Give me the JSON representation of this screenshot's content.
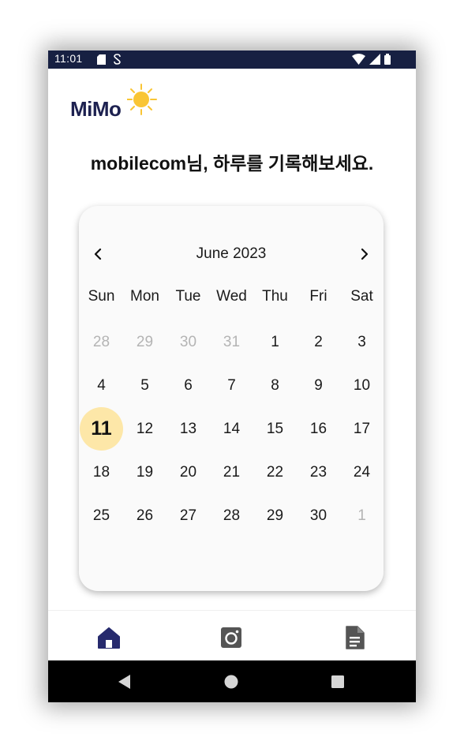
{
  "status_bar": {
    "time": "11:01",
    "icons_left": [
      "sd-card-icon",
      "sync-icon"
    ],
    "icons_right": [
      "wifi-icon",
      "signal-icon",
      "battery-icon"
    ]
  },
  "app": {
    "logo_text": "MiMo",
    "greeting": "mobilecom님, 하루를 기록해보세요."
  },
  "calendar": {
    "month_label": "June 2023",
    "prev_icon": "chevron-left-icon",
    "next_icon": "chevron-right-icon",
    "weekdays": [
      "Sun",
      "Mon",
      "Tue",
      "Wed",
      "Thu",
      "Fri",
      "Sat"
    ],
    "weeks": [
      [
        {
          "d": "28",
          "muted": true
        },
        {
          "d": "29",
          "muted": true
        },
        {
          "d": "30",
          "muted": true
        },
        {
          "d": "31",
          "muted": true
        },
        {
          "d": "1"
        },
        {
          "d": "2"
        },
        {
          "d": "3"
        }
      ],
      [
        {
          "d": "4"
        },
        {
          "d": "5"
        },
        {
          "d": "6"
        },
        {
          "d": "7"
        },
        {
          "d": "8"
        },
        {
          "d": "9"
        },
        {
          "d": "10"
        }
      ],
      [
        {
          "d": "11",
          "today": true
        },
        {
          "d": "12"
        },
        {
          "d": "13"
        },
        {
          "d": "14"
        },
        {
          "d": "15"
        },
        {
          "d": "16"
        },
        {
          "d": "17"
        }
      ],
      [
        {
          "d": "18"
        },
        {
          "d": "19"
        },
        {
          "d": "20"
        },
        {
          "d": "21"
        },
        {
          "d": "22"
        },
        {
          "d": "23"
        },
        {
          "d": "24"
        }
      ],
      [
        {
          "d": "25"
        },
        {
          "d": "26"
        },
        {
          "d": "27"
        },
        {
          "d": "28"
        },
        {
          "d": "29"
        },
        {
          "d": "30"
        },
        {
          "d": "1",
          "muted": true
        }
      ]
    ]
  },
  "bottom_nav": {
    "items": [
      {
        "icon": "home-icon",
        "active": true
      },
      {
        "icon": "camera-icon",
        "active": false
      },
      {
        "icon": "document-icon",
        "active": false
      }
    ]
  },
  "colors": {
    "status_bar": "#172042",
    "brand_navy": "#1d2150",
    "sun": "#f9c534",
    "today_highlight": "#fde7a8",
    "active_nav": "#262a6d",
    "inactive_nav": "#555555"
  }
}
